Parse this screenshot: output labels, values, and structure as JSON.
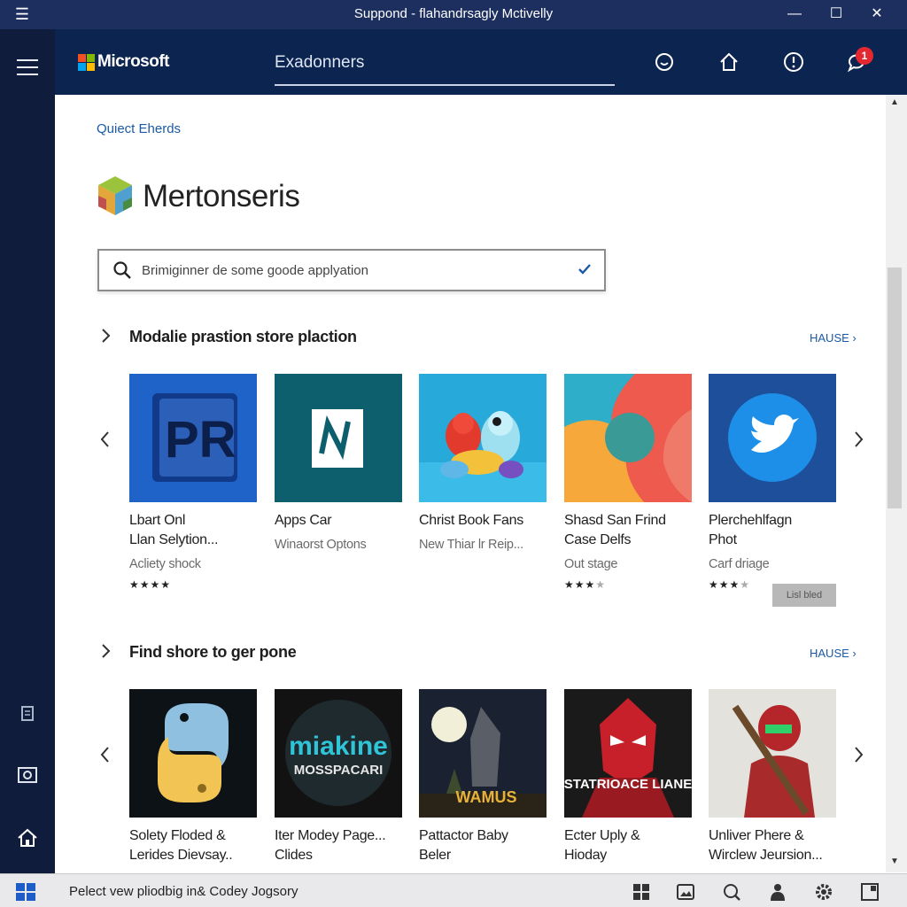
{
  "window": {
    "title": "Suppond - flahandrsagly Mctivelly",
    "menu_glyph": "☰",
    "minimize": "—",
    "maximize": "☐",
    "close": "✕"
  },
  "header": {
    "brand": "Microsoft",
    "search_text": "Exadonners",
    "badge_count": "1",
    "colors": {
      "background": "#0c2450",
      "titlebar": "#1c2f5f",
      "badge": "#e5282f"
    }
  },
  "page": {
    "breadcrumb": "Quiect Eherds",
    "app_title": "Mertonseris",
    "search": {
      "placeholder": "Brimiginner de some goode applyation"
    }
  },
  "sections": [
    {
      "title": "Modalie prastion store plaction",
      "more_label": "HAUSE",
      "apps": [
        {
          "name_line1": "Lbart Onl",
          "name_line2": "Llan Selytion...",
          "subtitle": "Acliety shock",
          "rating": 4,
          "icon": "pr-app-icon"
        },
        {
          "name_line1": "Apps Car",
          "name_line2": "",
          "subtitle": "Winaorst Optons",
          "rating": 0,
          "icon": "n-app-icon"
        },
        {
          "name_line1": "Christ Book Fans",
          "name_line2": "",
          "subtitle": "New Thiar lr Reip...",
          "rating": 0,
          "icon": "cartoon-birds-icon"
        },
        {
          "name_line1": "Shasd San Frind",
          "name_line2": "Case Delfs",
          "subtitle": "Out stage",
          "rating": 3,
          "icon": "abstract-shapes-icon"
        },
        {
          "name_line1": "Plerchehlfagn",
          "name_line2": "Phot",
          "subtitle": "Carf driage",
          "rating": 3.5,
          "icon": "twitter-bird-icon"
        }
      ],
      "tag_label": "Lisl bled"
    },
    {
      "title": "Find shore to ger pone",
      "more_label": "HAUSE",
      "apps": [
        {
          "name_line1": "Solety Floded &",
          "name_line2": "Lerides Dievsay..",
          "icon": "python-logo-icon"
        },
        {
          "name_line1": "Iter Modey Page...",
          "name_line2": "Clides",
          "tile_text1": "miakine",
          "tile_text2": "MOSSPACARI",
          "icon": "miakine-game-icon"
        },
        {
          "name_line1": "Pattactor Baby",
          "name_line2": "Beler",
          "tile_text1": "WAMUS",
          "icon": "night-warrior-icon"
        },
        {
          "name_line1": "Ecter Uply &",
          "name_line2": "Hioday",
          "tile_text1": "STATRIOACE LIANE",
          "icon": "red-hero-icon"
        },
        {
          "name_line1": "Unliver Phere &",
          "name_line2": "Wirclew Jeursion...",
          "icon": "red-warrior-icon"
        }
      ]
    }
  ],
  "taskbar": {
    "text": "Pelect vew pliodbig in& Codey Jogsory"
  }
}
